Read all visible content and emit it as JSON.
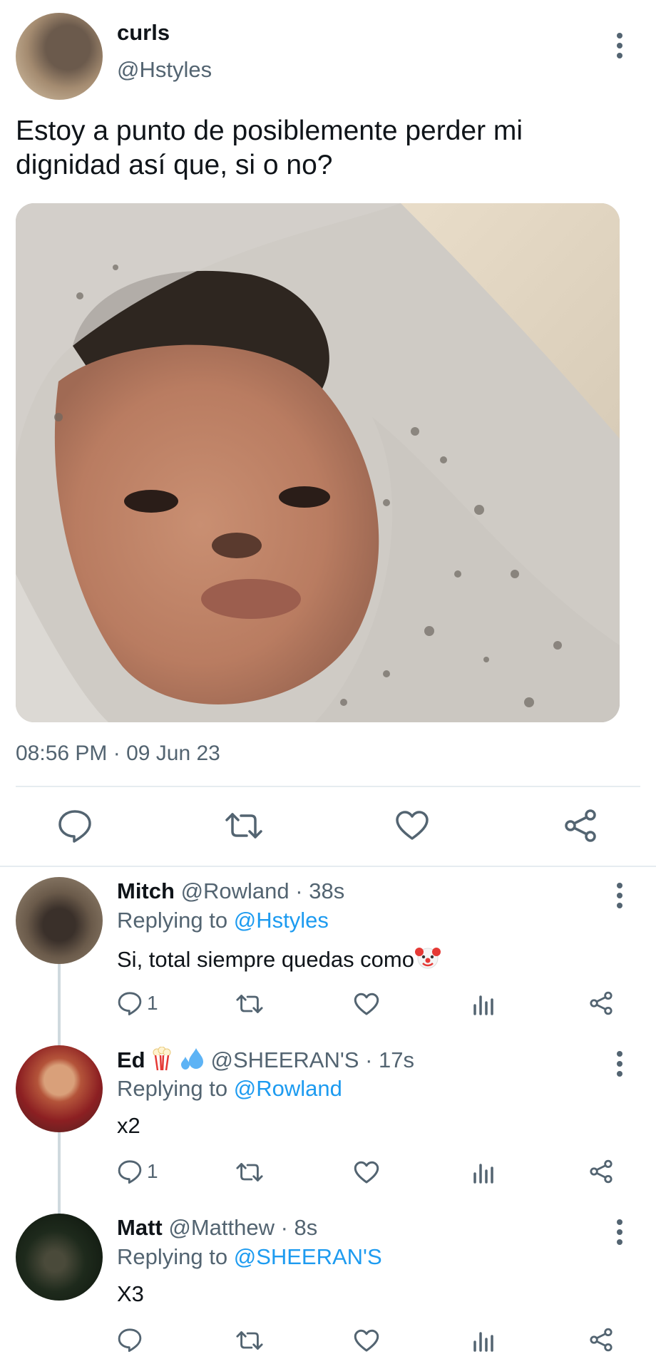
{
  "tweet": {
    "name": "curls",
    "handle": "@Hstyles",
    "text_line1": "Estoy a punto de posiblemente perder mi",
    "text_line2": "dignidad así que, si o no?",
    "timestamp": "08:56 PM · 09 Jun 23",
    "actions": [
      "reply-icon",
      "retweet-icon",
      "like-icon",
      "share-icon"
    ]
  },
  "replies": [
    {
      "name": "Mitch",
      "handle": "@Rowland",
      "time": "· 38s",
      "replying_prefix": "Replying to",
      "replying_to": "@Hstyles",
      "text": "Si, total siempre quedas como",
      "emoji": "clown-face-icon",
      "reply_count": "1"
    },
    {
      "name": "Ed",
      "emojis": [
        "popcorn-icon",
        "sweat-droplets-icon"
      ],
      "handle": "@SHEERAN'S",
      "time": "· 17s",
      "replying_prefix": "Replying to",
      "replying_to": "@Rowland",
      "text": "x2",
      "reply_count": "1"
    },
    {
      "name": "Matt",
      "handle": "@Matthew",
      "time": "· 8s",
      "replying_prefix": "Replying to",
      "replying_to": "@SHEERAN'S",
      "text": "X3",
      "reply_count": ""
    }
  ],
  "colors": {
    "link": "#1d9bf0",
    "muted": "#536471",
    "divider": "#e6ecf0"
  }
}
